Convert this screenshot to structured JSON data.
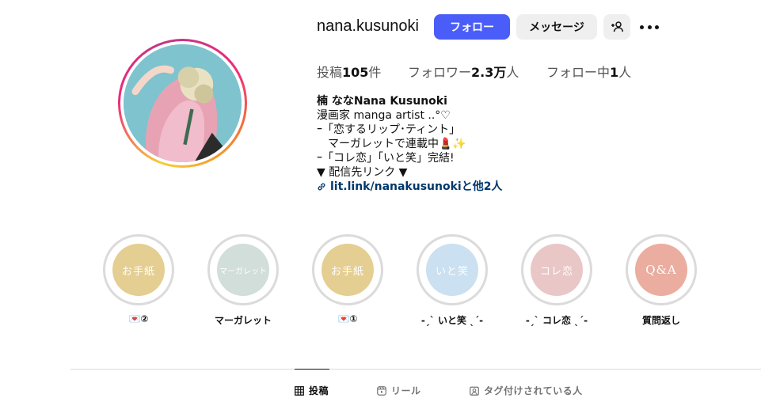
{
  "profile": {
    "username": "nana.kusunoki",
    "follow_label": "フォロー",
    "message_label": "メッセージ",
    "add_user_icon": "person-add-icon",
    "more_icon": "more-dots-icon"
  },
  "stats": {
    "posts_label": "投稿",
    "posts_value": "105",
    "posts_unit": "件",
    "followers_label": "フォロワー",
    "followers_value": "2.3万",
    "followers_unit": "人",
    "following_label": "フォロー中",
    "following_value": "1",
    "following_unit": "人"
  },
  "bio": {
    "name": "楠 ななNana Kusunoki",
    "line1": "漫画家 manga artist ..°♡",
    "line2": "ｰ「恋するリップ･ティント」",
    "line3": "マーガレットで連載中💄✨",
    "line4": "ｰ「コレ恋」「いと笑」完結!",
    "line5": "▼ 配信先リンク ▼",
    "link": "lit.link/nanakusunokiと他2人"
  },
  "highlights": [
    {
      "label": "💌②",
      "cover_text": "お手紙",
      "color": "#e3cc8c"
    },
    {
      "label": "マーガレット",
      "cover_text": "マーガレット",
      "color": "#cfddd7"
    },
    {
      "label": "💌①",
      "cover_text": "お手紙",
      "color": "#e3cc8c"
    },
    {
      "label": "-ˏˋ いと笑 ˎˊ-",
      "cover_text": "いと笑",
      "color": "#c9dff0"
    },
    {
      "label": "-ˏˋ コレ恋 ˎˊ-",
      "cover_text": "コレ恋",
      "color": "#e8c5c5"
    },
    {
      "label": "質問返し",
      "cover_text": "Q&A",
      "color": "#e9a99a"
    }
  ],
  "tabs": {
    "posts": "投稿",
    "reels": "リール",
    "tagged": "タグ付けされている人"
  },
  "colors": {
    "accent": "#4a5df9",
    "link": "#00376b"
  }
}
